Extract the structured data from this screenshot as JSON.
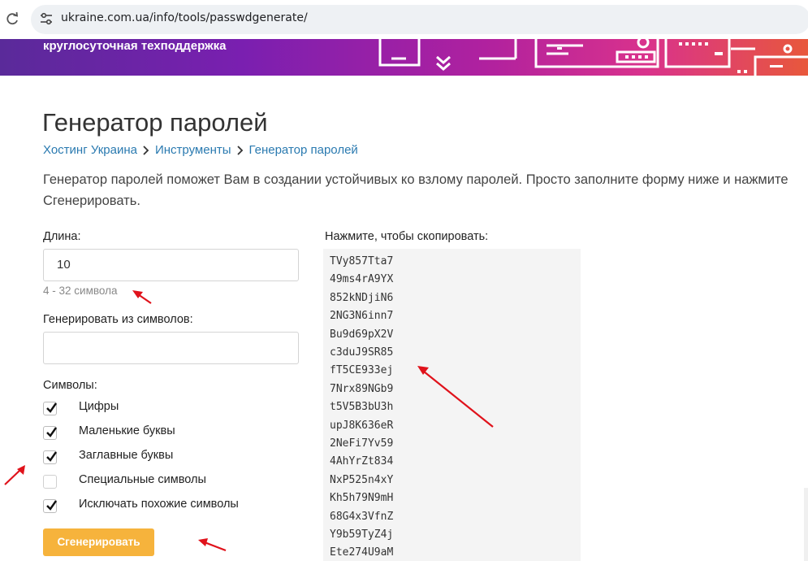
{
  "browser": {
    "url": "ukraine.com.ua/info/tools/passwdgenerate/"
  },
  "banner": {
    "text": "круглосуточная техподдержка"
  },
  "page": {
    "title": "Генератор паролей",
    "breadcrumb": [
      "Хостинг Украина",
      "Инструменты",
      "Генератор паролей"
    ],
    "intro": "Генератор паролей поможет Вам в создании устойчивых ко взлому паролей. Просто заполните форму ниже и нажмите Сгенерировать."
  },
  "form": {
    "length_label": "Длина:",
    "length_value": "10",
    "length_hint": "4 - 32 символа",
    "chars_label": "Генерировать из символов:",
    "chars_value": "",
    "symbols_label": "Символы:",
    "options": [
      {
        "label": "Цифры",
        "checked": true
      },
      {
        "label": "Маленькие буквы",
        "checked": true
      },
      {
        "label": "Заглавные буквы",
        "checked": true
      },
      {
        "label": "Специальные символы",
        "checked": false
      },
      {
        "label": "Исключать похожие символы",
        "checked": true
      }
    ],
    "generate_label": "Сгенерировать"
  },
  "results": {
    "copy_label": "Нажмите, чтобы скопировать:",
    "passwords": [
      "TVy857Tta7",
      "49ms4rA9YX",
      "852kNDjiN6",
      "2NG3N6inn7",
      "Bu9d69pX2V",
      "c3duJ9SR85",
      "fT5CE933ej",
      "7Nrx89NGb9",
      "t5V5B3bU3h",
      "upJ8K636eR",
      "2NeFi7Yv59",
      "4AhYrZt834",
      "NxP525n4xY",
      "Kh5h79N9mH",
      "68G4x3VfnZ",
      "Y9b59TyZ4j",
      "Ete274U9aM"
    ]
  },
  "colors": {
    "link": "#2a7ab0",
    "button": "#f6b33c",
    "annotation_arrow": "#e0121b"
  }
}
